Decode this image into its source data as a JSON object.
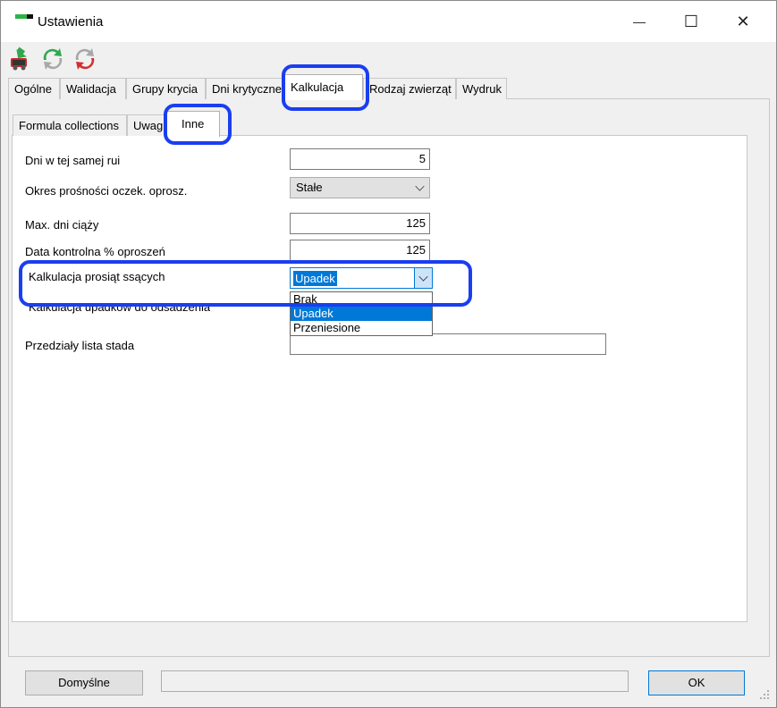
{
  "window": {
    "title": "Ustawienia",
    "min_glyph": "—",
    "max_glyph": "☐",
    "close_glyph": "✕"
  },
  "toolbar": {
    "icons": [
      "save-icon",
      "refresh-green-icon",
      "refresh-red-icon"
    ]
  },
  "tabs_main": [
    "Ogólne",
    "Walidacja",
    "Grupy krycia",
    "Dni krytyczne",
    "Kalkulacja",
    "Rodzaj zwierząt",
    "Wydruk"
  ],
  "tabs_sub": [
    "Formula collections",
    "Uwagi",
    "Inne"
  ],
  "form": {
    "dni_label": "Dni w tej samej rui",
    "dni_value": "5",
    "okres_label": "Okres prośności oczek. oprosz.",
    "okres_value": "Stałe",
    "max_dni_label": "Max. dni ciąży",
    "max_dni_value": "125",
    "data_kontrolna_label": "Data kontrolna % oproszeń",
    "data_kontrolna_value": "125",
    "kalk_prosiat_label": "Kalkulacja prosiąt ssących",
    "kalk_prosiat_value": "Upadek",
    "kalk_upadkow_label": "Kalkulacja upadków do odsadzenia",
    "przedzialy_label": "Przedziały lista stada",
    "przedzialy_value": ""
  },
  "dropdown": {
    "options": [
      "Brak",
      "Upadek",
      "Przeniesione"
    ],
    "selected": "Upadek"
  },
  "footer": {
    "default_label": "Domyślne",
    "ok_label": "OK"
  },
  "colors": {
    "highlight": "#1a3ef0",
    "selection": "#0078d7"
  }
}
